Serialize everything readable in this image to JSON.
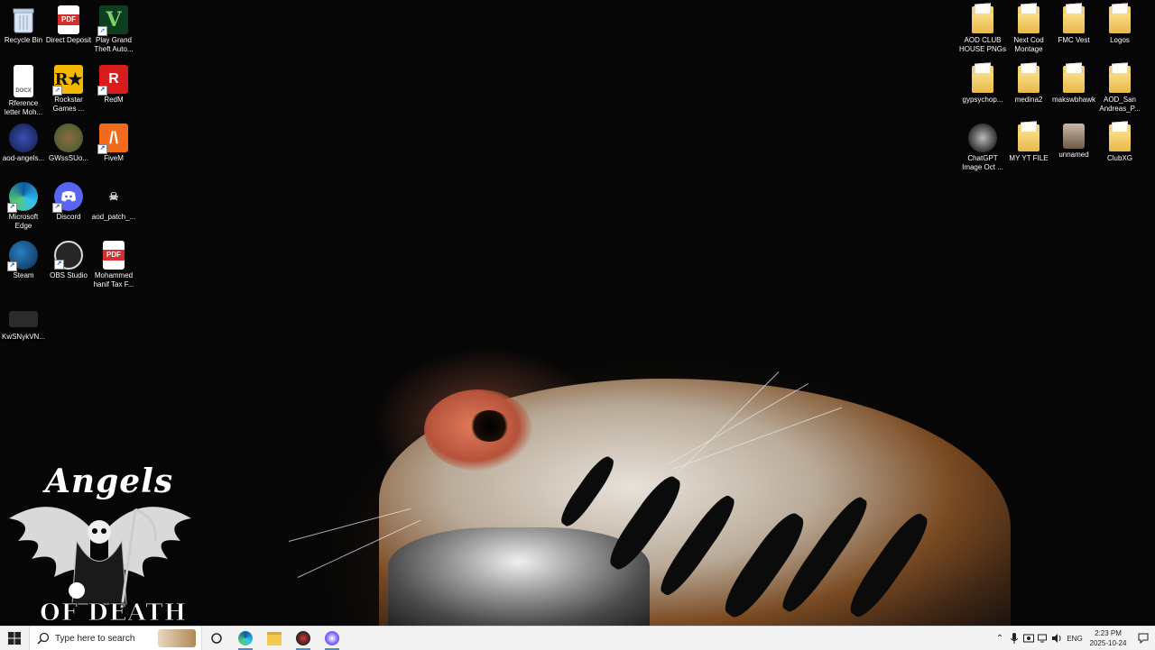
{
  "desktop_icons_left": [
    {
      "label": "Recycle Bin",
      "icon": "recycle-bin-icon"
    },
    {
      "label": "Direct Deposit",
      "icon": "pdf-file-icon"
    },
    {
      "label": "Play Grand Theft Auto...",
      "icon": "gta-v-icon"
    },
    {
      "label": "Rference letter Moh...",
      "icon": "docx-file-icon"
    },
    {
      "label": "Rockstar Games ...",
      "icon": "rockstar-games-icon"
    },
    {
      "label": "RedM",
      "icon": "redm-icon"
    },
    {
      "label": "aod-angels...",
      "icon": "image-file-icon"
    },
    {
      "label": "GWssSUo...",
      "icon": "image-file-icon"
    },
    {
      "label": "FiveM",
      "icon": "fivem-icon"
    },
    {
      "label": "Microsoft Edge",
      "icon": "edge-icon"
    },
    {
      "label": "Discord",
      "icon": "discord-icon"
    },
    {
      "label": "aod_patch_...",
      "icon": "image-file-icon"
    },
    {
      "label": "Steam",
      "icon": "steam-icon"
    },
    {
      "label": "OBS Studio",
      "icon": "obs-icon"
    },
    {
      "label": "Mohammed hanif Tax F...",
      "icon": "pdf-file-icon"
    },
    {
      "label": "KwSNykVN...",
      "icon": "image-file-icon"
    }
  ],
  "desktop_icons_right": [
    {
      "label": "AOD CLUB HOUSE PNGs",
      "icon": "folder-icon"
    },
    {
      "label": "Next Cod Montage",
      "icon": "folder-icon"
    },
    {
      "label": "FMC Vest",
      "icon": "folder-icon"
    },
    {
      "label": "Logos",
      "icon": "folder-icon"
    },
    {
      "label": "gypsychop...",
      "icon": "folder-icon"
    },
    {
      "label": "medina2",
      "icon": "folder-icon"
    },
    {
      "label": "makswbhawk",
      "icon": "folder-icon"
    },
    {
      "label": "AOD_San Andreas_P...",
      "icon": "folder-icon"
    },
    {
      "label": "ChatGPT Image Oct ...",
      "icon": "image-file-icon"
    },
    {
      "label": "MY YT FILE",
      "icon": "folder-icon"
    },
    {
      "label": "unnamed",
      "icon": "image-file-icon"
    },
    {
      "label": "ClubXG",
      "icon": "folder-icon"
    }
  ],
  "wallpaper": {
    "logo_top": "Angels",
    "logo_bottom": "OF DEATH"
  },
  "taskbar": {
    "search_placeholder": "Type here to search",
    "language": "ENG",
    "time": "2:23 PM",
    "date": "2025-10-24"
  },
  "colors": {
    "taskbar_bg": "#f3f3f3",
    "accent": "#4a8ad6",
    "folder": "#f2c94c"
  }
}
